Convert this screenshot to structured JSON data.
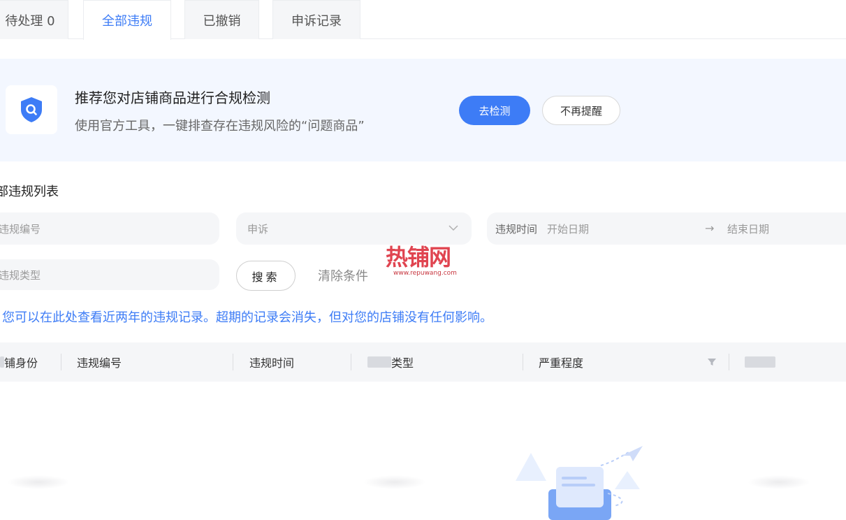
{
  "tabs": [
    {
      "label": "待处理 0"
    },
    {
      "label": "全部违规"
    },
    {
      "label": "已撤销"
    },
    {
      "label": "申诉记录"
    }
  ],
  "active_tab_index": 1,
  "banner": {
    "title": "推荐您对店铺商品进行合规检测",
    "subtitle": "使用官方工具，一键排查存在违规风险的“问题商品”",
    "primary_button": "去检测",
    "secondary_button": "不再提醒",
    "icon": "shield-search-icon"
  },
  "section_title": "部违规列表",
  "filters": {
    "violation_code_placeholder": "违规编号",
    "appeal_placeholder": "申诉",
    "time_label": "违规时间",
    "start_placeholder": "开始日期",
    "end_placeholder": "结束日期",
    "type_placeholder": "违规类型",
    "search_button": "搜索",
    "clear_link": "清除条件"
  },
  "watermark": {
    "text": "热铺网",
    "url": "www.repuwang.com"
  },
  "notice": "您可以在此处查看近两年的违规记录。超期的记录会消失，但对您的店铺没有任何影响。",
  "table": {
    "columns": [
      "铺身份",
      "违规编号",
      "违规时间",
      "类型",
      "严重程度"
    ]
  },
  "colors": {
    "accent": "#3d7cf6",
    "banner_bg": "#f3f7ff",
    "field_bg": "#f5f6f8"
  }
}
